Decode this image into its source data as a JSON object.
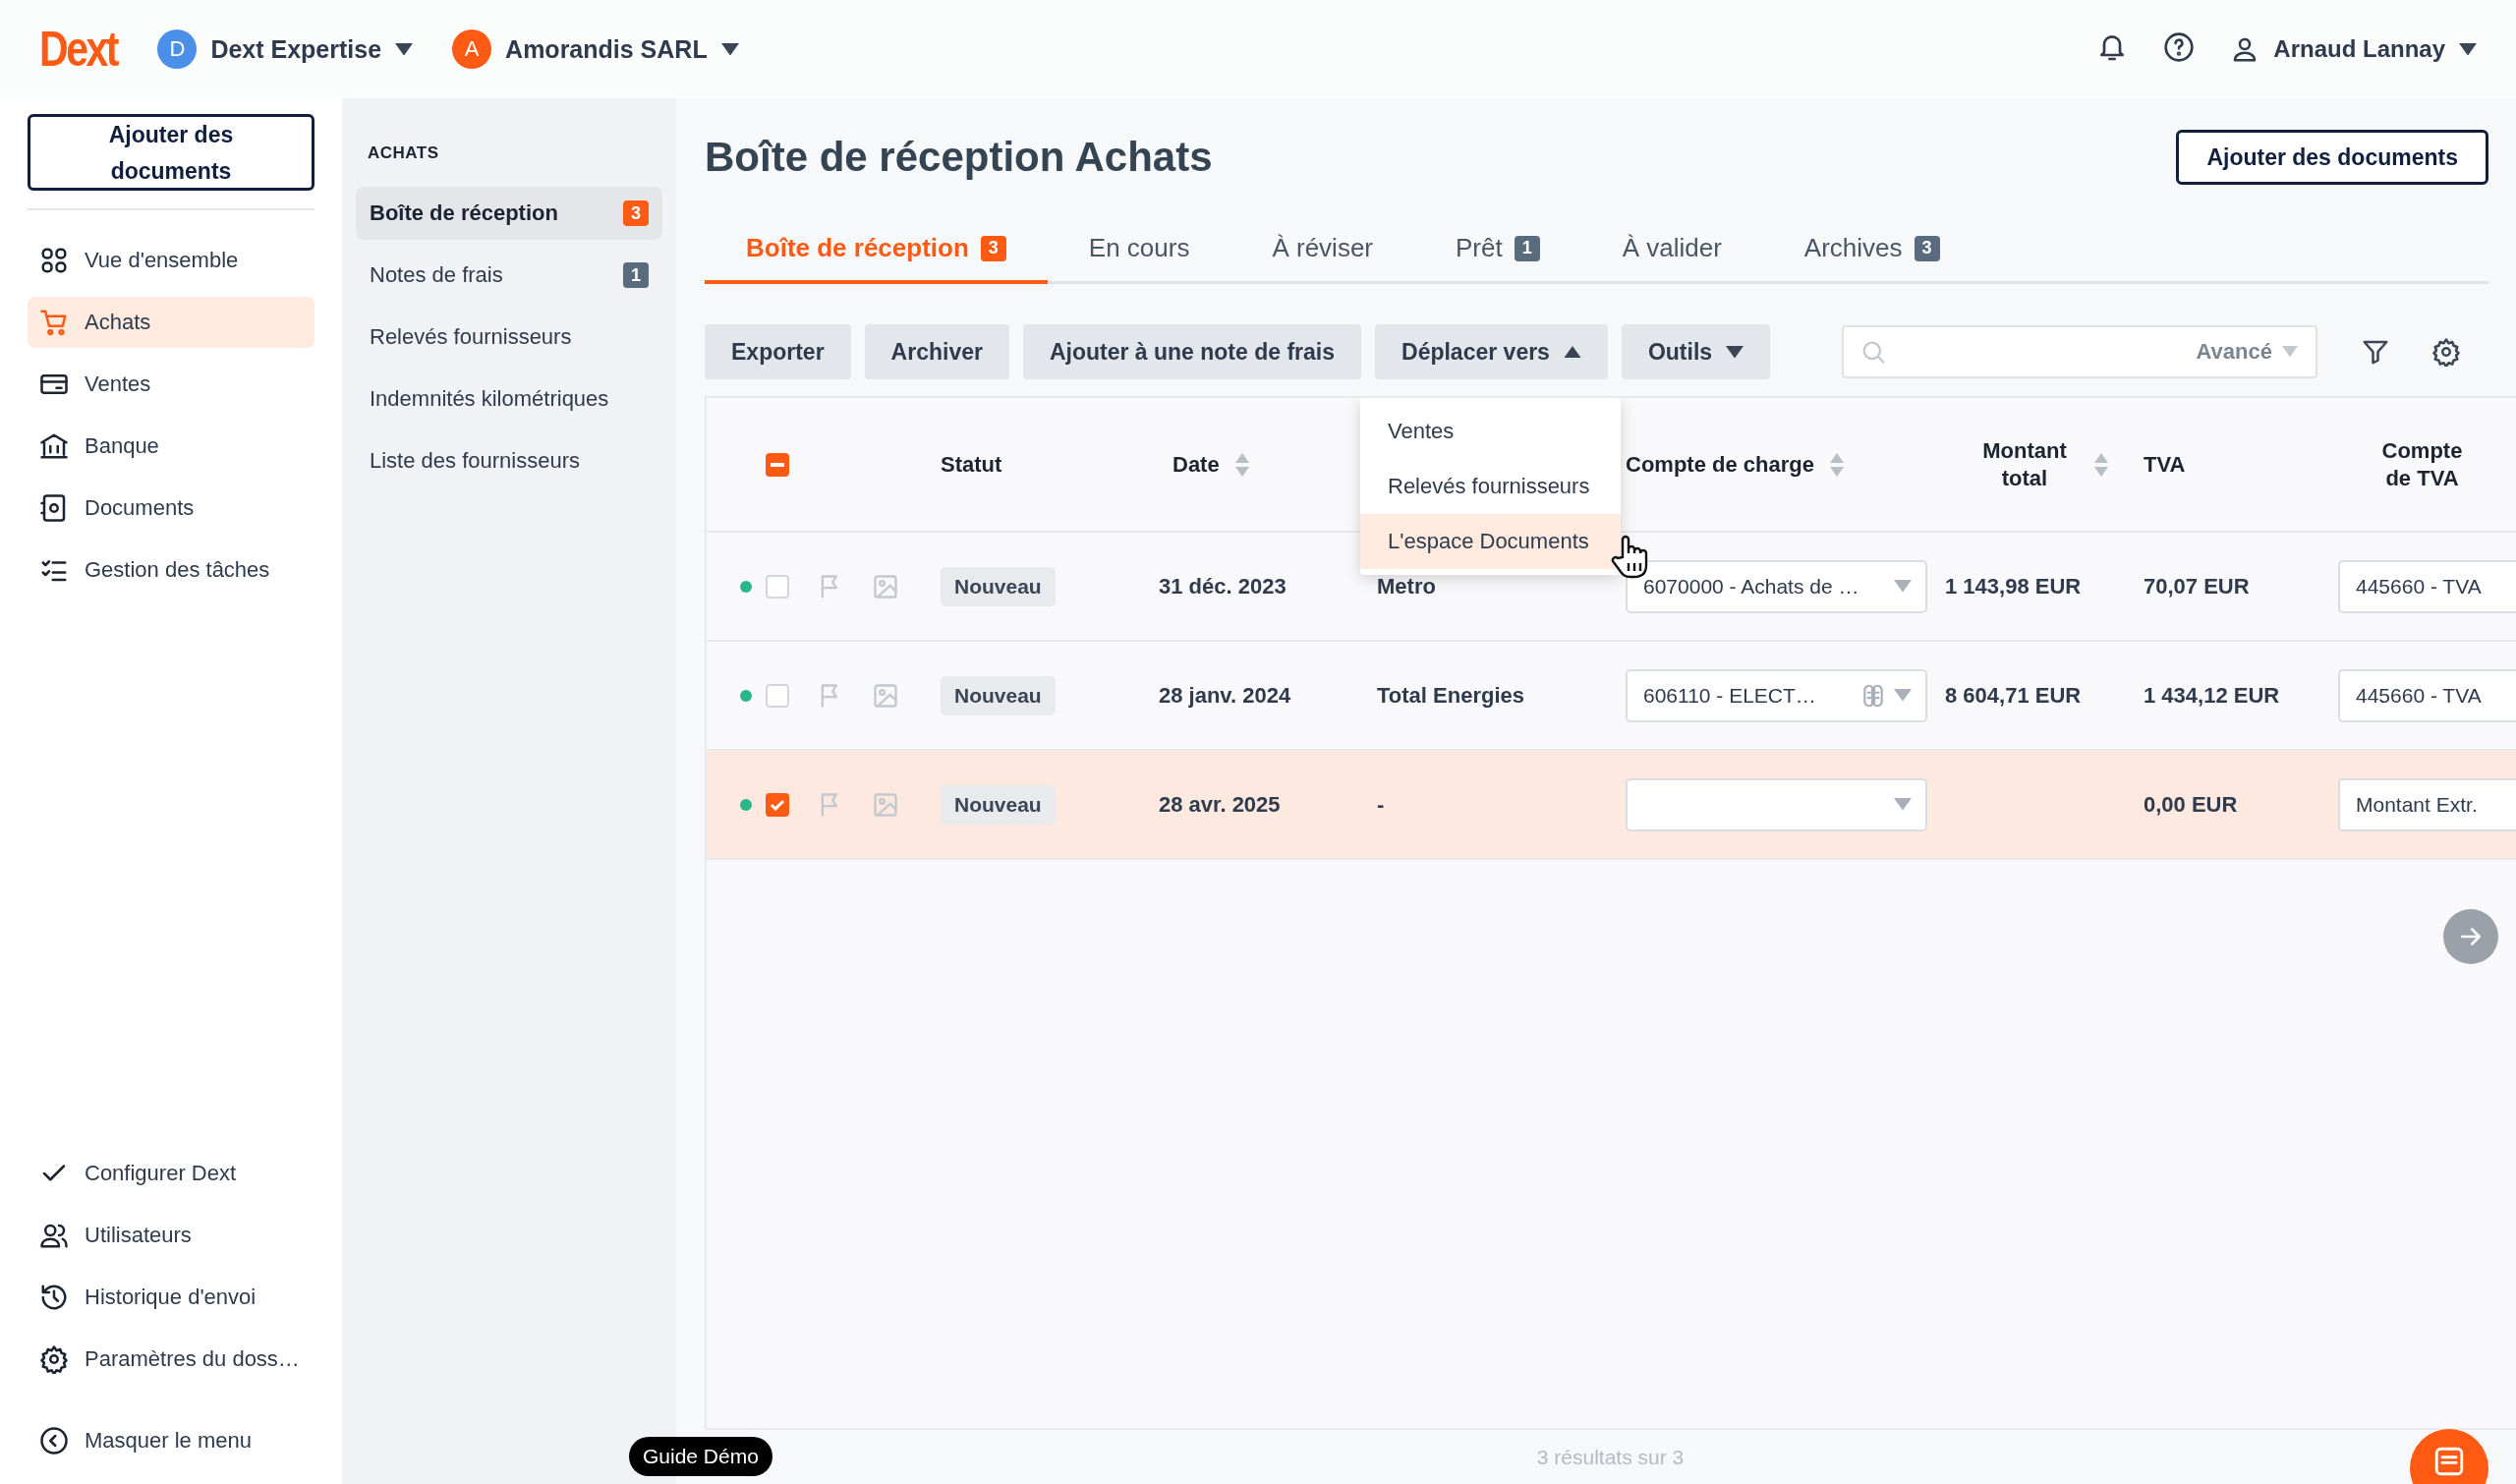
{
  "topbar": {
    "logo": "Dext",
    "workspaces": [
      {
        "initial": "D",
        "name": "Dext Expertise",
        "color": "#4a8fe8"
      },
      {
        "initial": "A",
        "name": "Amorandis SARL",
        "color": "#ff5a14"
      }
    ],
    "user": "Arnaud Lannay"
  },
  "sidebar": {
    "add_button": "Ajouter des documents",
    "items": [
      {
        "label": "Vue d'ensemble",
        "selected": false
      },
      {
        "label": "Achats",
        "selected": true
      },
      {
        "label": "Ventes",
        "selected": false
      },
      {
        "label": "Banque",
        "selected": false
      },
      {
        "label": "Documents",
        "selected": false
      },
      {
        "label": "Gestion des tâches",
        "selected": false
      }
    ],
    "footer_items": [
      {
        "label": "Configurer Dext"
      },
      {
        "label": "Utilisateurs"
      },
      {
        "label": "Historique d'envoi"
      },
      {
        "label": "Paramètres du doss…"
      }
    ],
    "collapse": "Masquer le menu"
  },
  "subnav": {
    "heading": "ACHATS",
    "items": [
      {
        "label": "Boîte de réception",
        "count": "3",
        "selected": true
      },
      {
        "label": "Notes de frais",
        "count": "1",
        "selected": false
      },
      {
        "label": "Relevés fournisseurs",
        "selected": false
      },
      {
        "label": "Indemnités kilométriques",
        "selected": false
      },
      {
        "label": "Liste des fournisseurs",
        "selected": false
      }
    ]
  },
  "page": {
    "title": "Boîte de réception Achats",
    "add_button": "Ajouter des documents"
  },
  "tabs": [
    {
      "label": "Boîte de réception",
      "count": "3",
      "selected": true
    },
    {
      "label": "En cours",
      "selected": false
    },
    {
      "label": "À réviser",
      "selected": false
    },
    {
      "label": "Prêt",
      "count": "1",
      "selected": false
    },
    {
      "label": "À valider",
      "selected": false
    },
    {
      "label": "Archives",
      "count": "3",
      "selected": false
    }
  ],
  "toolbar": {
    "buttons": [
      {
        "label": "Exporter",
        "kind": "plain"
      },
      {
        "label": "Archiver",
        "kind": "plain"
      },
      {
        "label": "Ajouter à une note de frais",
        "kind": "plain"
      },
      {
        "label": "Déplacer vers",
        "kind": "open"
      },
      {
        "label": "Outils",
        "kind": "closed"
      }
    ],
    "search": {
      "advanced": "Avancé"
    }
  },
  "menu": {
    "items": [
      {
        "label": "Ventes",
        "selected": false
      },
      {
        "label": "Relevés fournisseurs",
        "selected": false
      },
      {
        "label": "L'espace Documents",
        "selected": true
      }
    ]
  },
  "table": {
    "select_all_indeterminate": true,
    "columns": [
      {
        "label": "Statut",
        "sortable": false
      },
      {
        "label": "Date",
        "sortable": true
      },
      {
        "label": "Compte de charge",
        "sortable": true
      },
      {
        "label": "Montant total",
        "sortable": true
      },
      {
        "label": "TVA",
        "sortable": false
      },
      {
        "label": "Compte de TVA",
        "sortable": false
      }
    ],
    "rows": [
      {
        "checked": false,
        "status": "Nouveau",
        "date": "31 déc. 2023",
        "supplier": "Metro",
        "expense_account": "6070000 - Achats de …",
        "suggested": false,
        "total": "1 143,98 EUR",
        "tax": "70,07 EUR",
        "tax_account": "445660 - TVA"
      },
      {
        "checked": false,
        "status": "Nouveau",
        "date": "28 janv. 2024",
        "supplier": "Total Energies",
        "expense_account": "606110 - ELECT…",
        "suggested": true,
        "total": "8 604,71 EUR",
        "tax": "1 434,12 EUR",
        "tax_account": "445660 - TVA"
      },
      {
        "checked": true,
        "status": "Nouveau",
        "date": "28 avr. 2025",
        "supplier": "-",
        "expense_account": "",
        "suggested": false,
        "total": "",
        "tax": "0,00 EUR",
        "tax_account": "Montant Extr."
      }
    ]
  },
  "footer": {
    "guide": "Guide Démo",
    "results": "3 résultats sur 3"
  }
}
